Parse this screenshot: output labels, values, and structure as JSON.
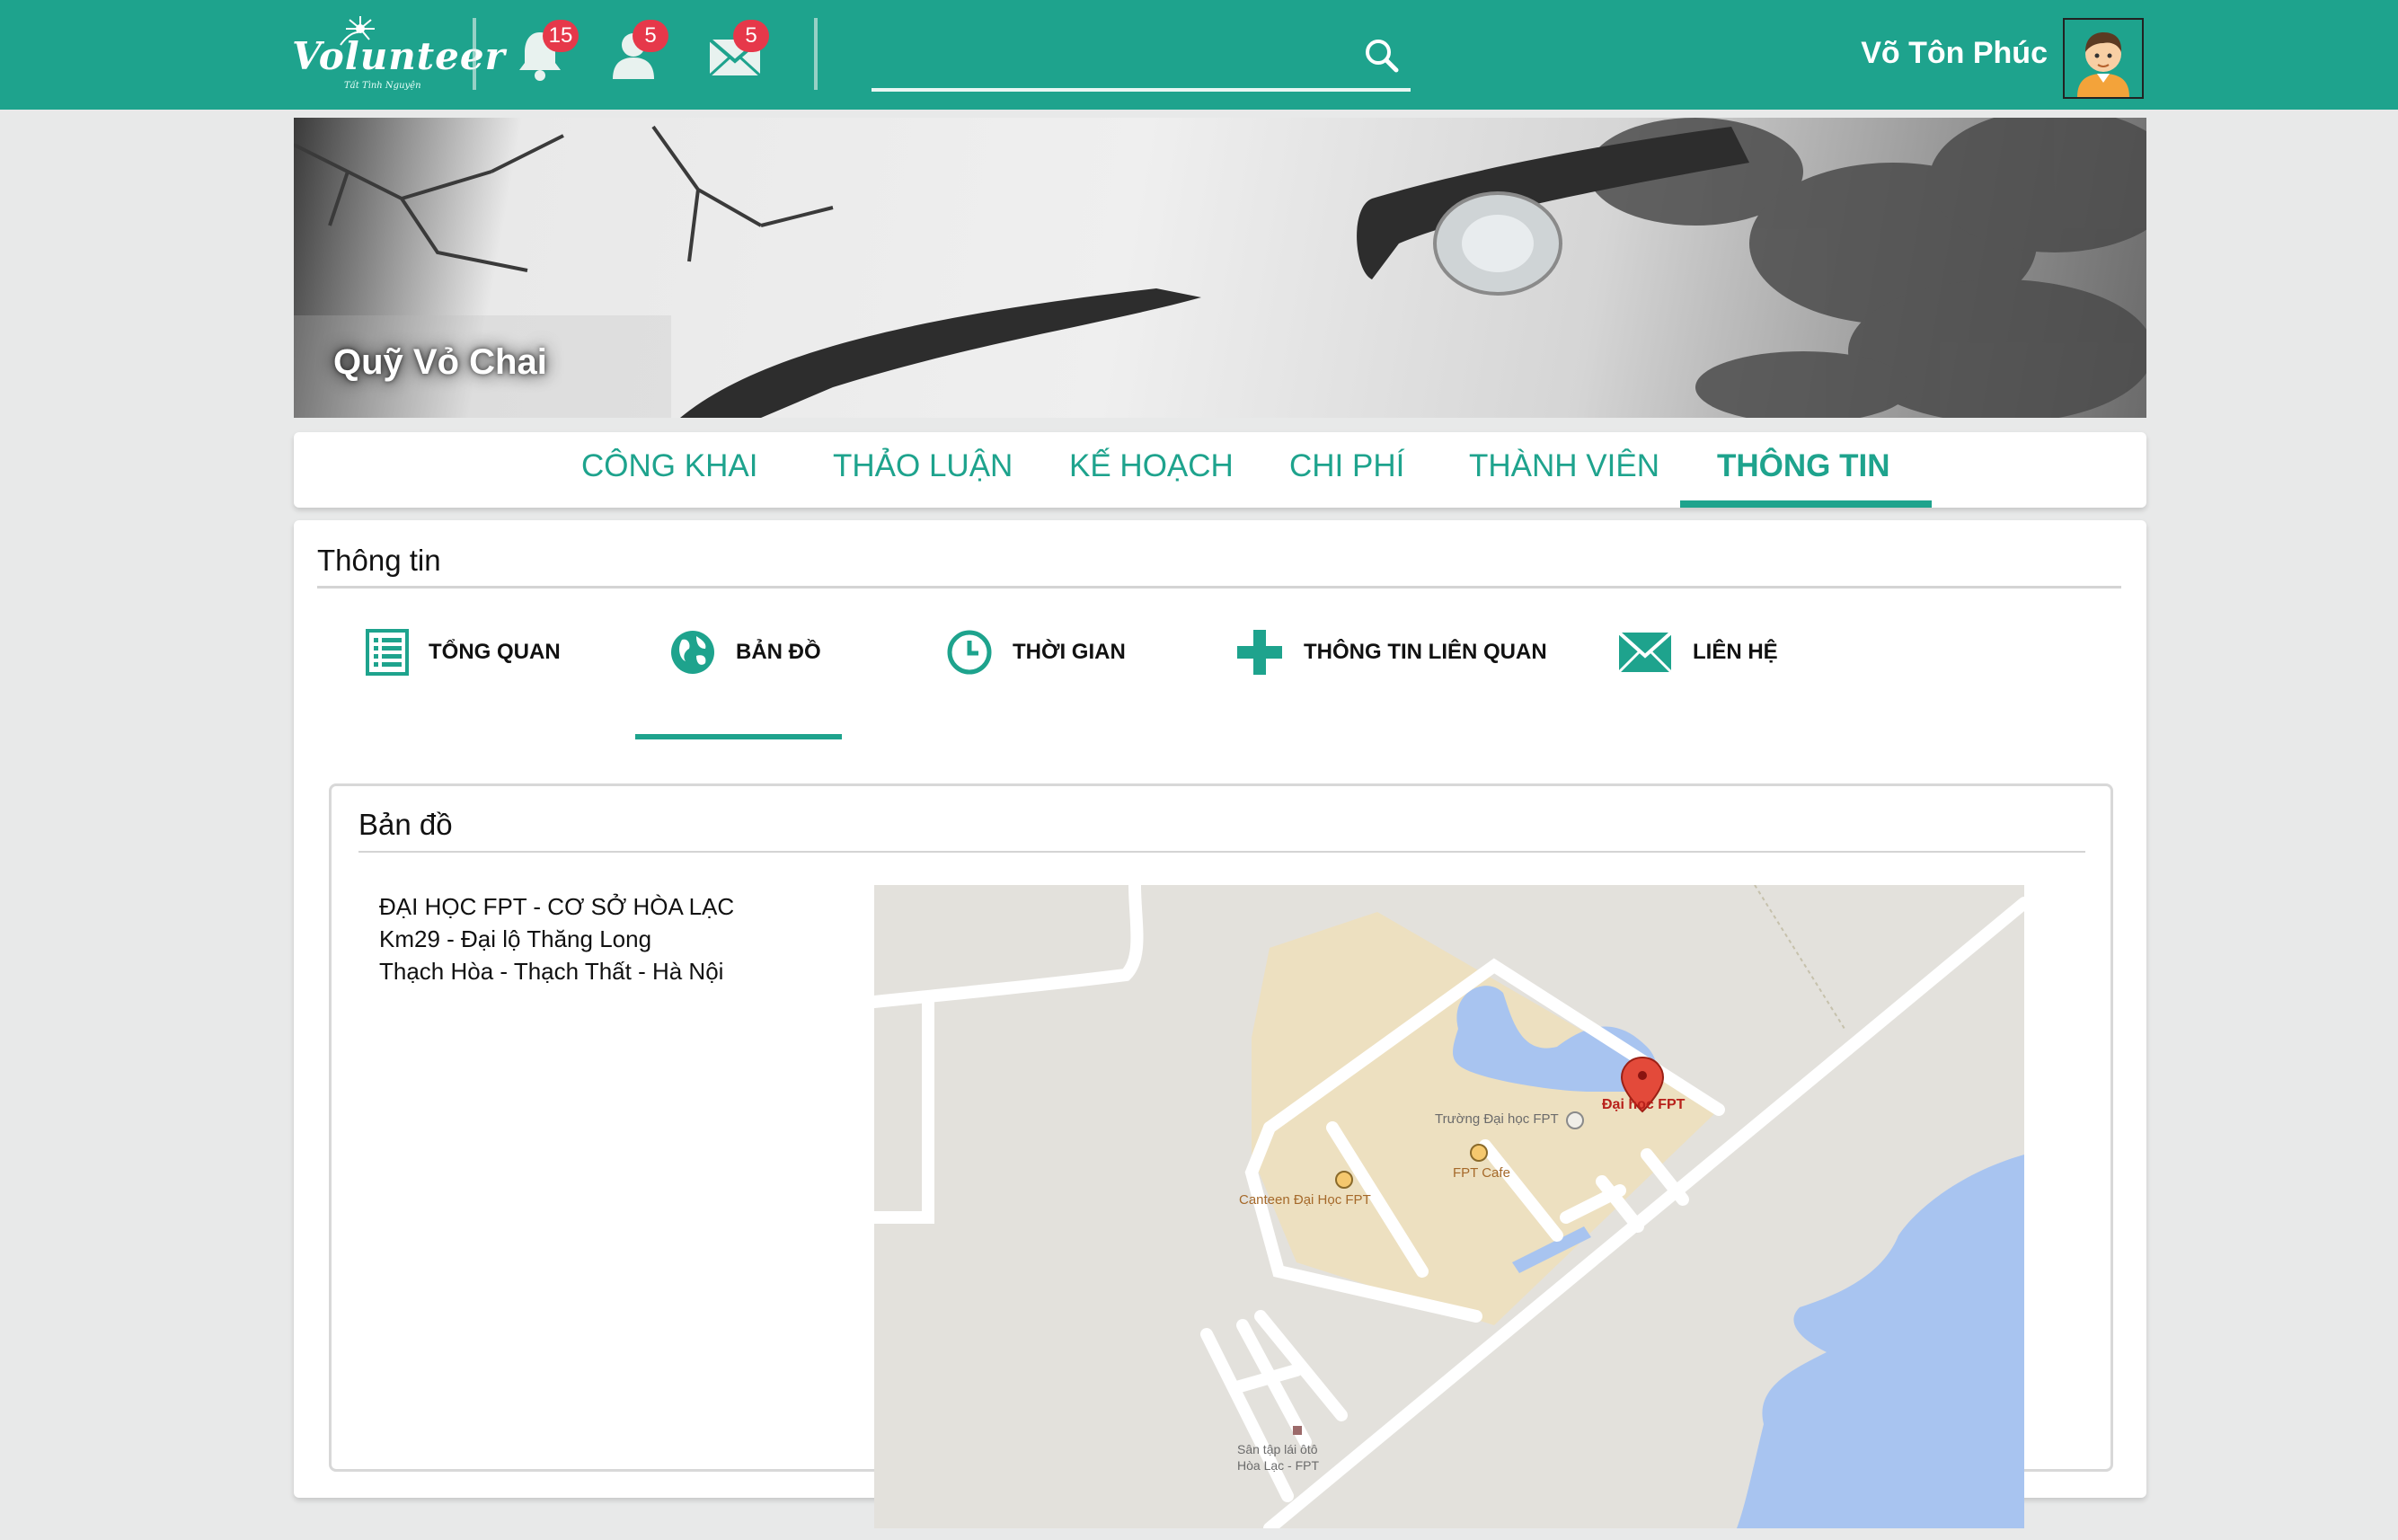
{
  "colors": {
    "brand": "#1ea38d",
    "badge": "#e6384a",
    "page_bg": "#e8e9e9"
  },
  "header": {
    "logo_text": "Volunteer",
    "logo_tagline": "Tất Tình Nguyện",
    "notifications": {
      "icon": "bell-icon",
      "count": "15"
    },
    "friend_requests": {
      "icon": "user-icon",
      "count": "5"
    },
    "messages": {
      "icon": "envelope-icon",
      "count": "5"
    },
    "search": {
      "placeholder": "",
      "icon": "search-icon"
    },
    "user": {
      "name": "Võ Tôn Phúc",
      "avatar_icon": "user-avatar"
    }
  },
  "cover": {
    "title": "Quỹ Vỏ Chai"
  },
  "main_tabs": [
    {
      "label": "CÔNG KHAI",
      "active": false
    },
    {
      "label": "THẢO LUẬN",
      "active": false
    },
    {
      "label": "KẾ HOẠCH",
      "active": false
    },
    {
      "label": "CHI PHÍ",
      "active": false
    },
    {
      "label": "THÀNH VIÊN",
      "active": false
    },
    {
      "label": "THÔNG TIN",
      "active": true
    }
  ],
  "info_panel": {
    "title": "Thông tin",
    "sub_tabs": [
      {
        "label": "TỔNG QUAN",
        "icon": "list-icon",
        "active": false
      },
      {
        "label": "BẢN ĐỒ",
        "icon": "globe-icon",
        "active": true
      },
      {
        "label": "THỜI GIAN",
        "icon": "clock-icon",
        "active": false
      },
      {
        "label": "THÔNG TIN LIÊN QUAN",
        "icon": "plus-icon",
        "active": false
      },
      {
        "label": "LIÊN HỆ",
        "icon": "envelope-icon",
        "active": false
      }
    ],
    "map_section": {
      "title": "Bản đồ",
      "address_lines": [
        "ĐẠI HỌC FPT - CƠ SỞ HÒA LẠC",
        "Km29 - Đại lộ Thăng Long",
        "Thạch Hòa - Thạch Thất - Hà Nội"
      ],
      "map_labels": {
        "marker": "Đại học FPT",
        "school": "Trường Đại học FPT",
        "cafe": "FPT Cafe",
        "canteen": "Canteen Đại Học FPT",
        "driving_1": "Sân tập lái ôtô",
        "driving_2": "Hòa Lạc - FPT"
      }
    }
  }
}
